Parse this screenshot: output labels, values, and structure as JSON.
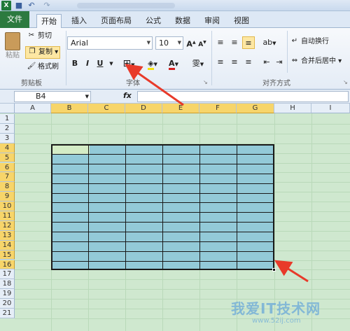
{
  "tabs": {
    "file": "文件",
    "home": "开始",
    "insert": "插入",
    "layout": "页面布局",
    "formulas": "公式",
    "data": "数据",
    "review": "审阅",
    "view": "视图"
  },
  "clipboard": {
    "paste": "粘贴",
    "cut": "剪切",
    "copy": "复制",
    "format_painter": "格式刷",
    "group_label": "剪贴板"
  },
  "font": {
    "name": "Arial",
    "size": "10",
    "bold": "B",
    "italic": "I",
    "underline": "U",
    "group_label": "字体",
    "wen": "雯"
  },
  "alignment": {
    "wrap": "自动换行",
    "merge": "合并后居中",
    "group_label": "对齐方式"
  },
  "formula_bar": {
    "name_box": "B4",
    "fx": "fx"
  },
  "columns": [
    "A",
    "B",
    "C",
    "D",
    "E",
    "F",
    "G",
    "H",
    "I"
  ],
  "rows": [
    "1",
    "2",
    "3",
    "4",
    "5",
    "6",
    "7",
    "8",
    "9",
    "10",
    "11",
    "12",
    "13",
    "14",
    "15",
    "16",
    "17",
    "18",
    "19",
    "20",
    "21"
  ],
  "selected_columns": [
    "B",
    "C",
    "D",
    "E",
    "F",
    "G"
  ],
  "selected_rows": [
    "4",
    "5",
    "6",
    "7",
    "8",
    "9",
    "10",
    "11",
    "12",
    "13",
    "14",
    "15",
    "16"
  ],
  "watermark": {
    "main": "我爱IT技术网",
    "url": "www.52ij.com"
  },
  "colors": {
    "file_tab": "#2c7a3f",
    "table_fill": "#93cad8",
    "sheet_bg": "#cfe8cf",
    "arrow": "#e83a2a"
  }
}
